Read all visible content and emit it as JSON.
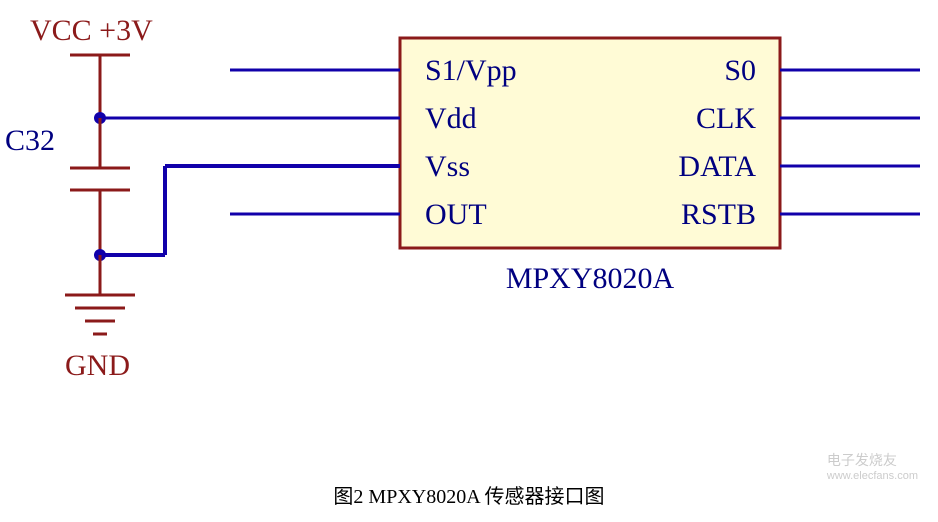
{
  "chart_data": {
    "type": "schematic",
    "component": {
      "part_number": "MPXY8020A",
      "description": "Sensor interface",
      "pins_left": [
        {
          "order": 1,
          "name": "S1/Vpp"
        },
        {
          "order": 2,
          "name": "Vdd",
          "connected_to": "VCC +3V",
          "via": "C32 (decoupling) to GND"
        },
        {
          "order": 3,
          "name": "Vss",
          "connected_to": "GND"
        },
        {
          "order": 4,
          "name": "OUT"
        }
      ],
      "pins_right": [
        {
          "order": 1,
          "name": "S0"
        },
        {
          "order": 2,
          "name": "CLK"
        },
        {
          "order": 3,
          "name": "DATA"
        },
        {
          "order": 4,
          "name": "RSTB"
        }
      ]
    },
    "power": {
      "vcc_label": "VCC +3V",
      "gnd_label": "GND",
      "decoupling_cap": "C32"
    }
  },
  "labels": {
    "vcc": "VCC +3V",
    "gnd": "GND",
    "cap": "C32",
    "part": "MPXY8020A",
    "pin_l1": "S1/Vpp",
    "pin_l2": "Vdd",
    "pin_l3": "Vss",
    "pin_l4": "OUT",
    "pin_r1": "S0",
    "pin_r2": "CLK",
    "pin_r3": "DATA",
    "pin_r4": "RSTB"
  },
  "caption": "图2 MPXY8020A  传感器接口图",
  "watermark": {
    "brand": "电子发烧友",
    "url": "www.elecfans.com"
  },
  "colors": {
    "wire": "#1100aa",
    "power": "#8b1a1a",
    "box_fill": "#fffbd6",
    "box_stroke": "#8b1a1a",
    "text": "#000080",
    "junction": "#1100aa"
  }
}
